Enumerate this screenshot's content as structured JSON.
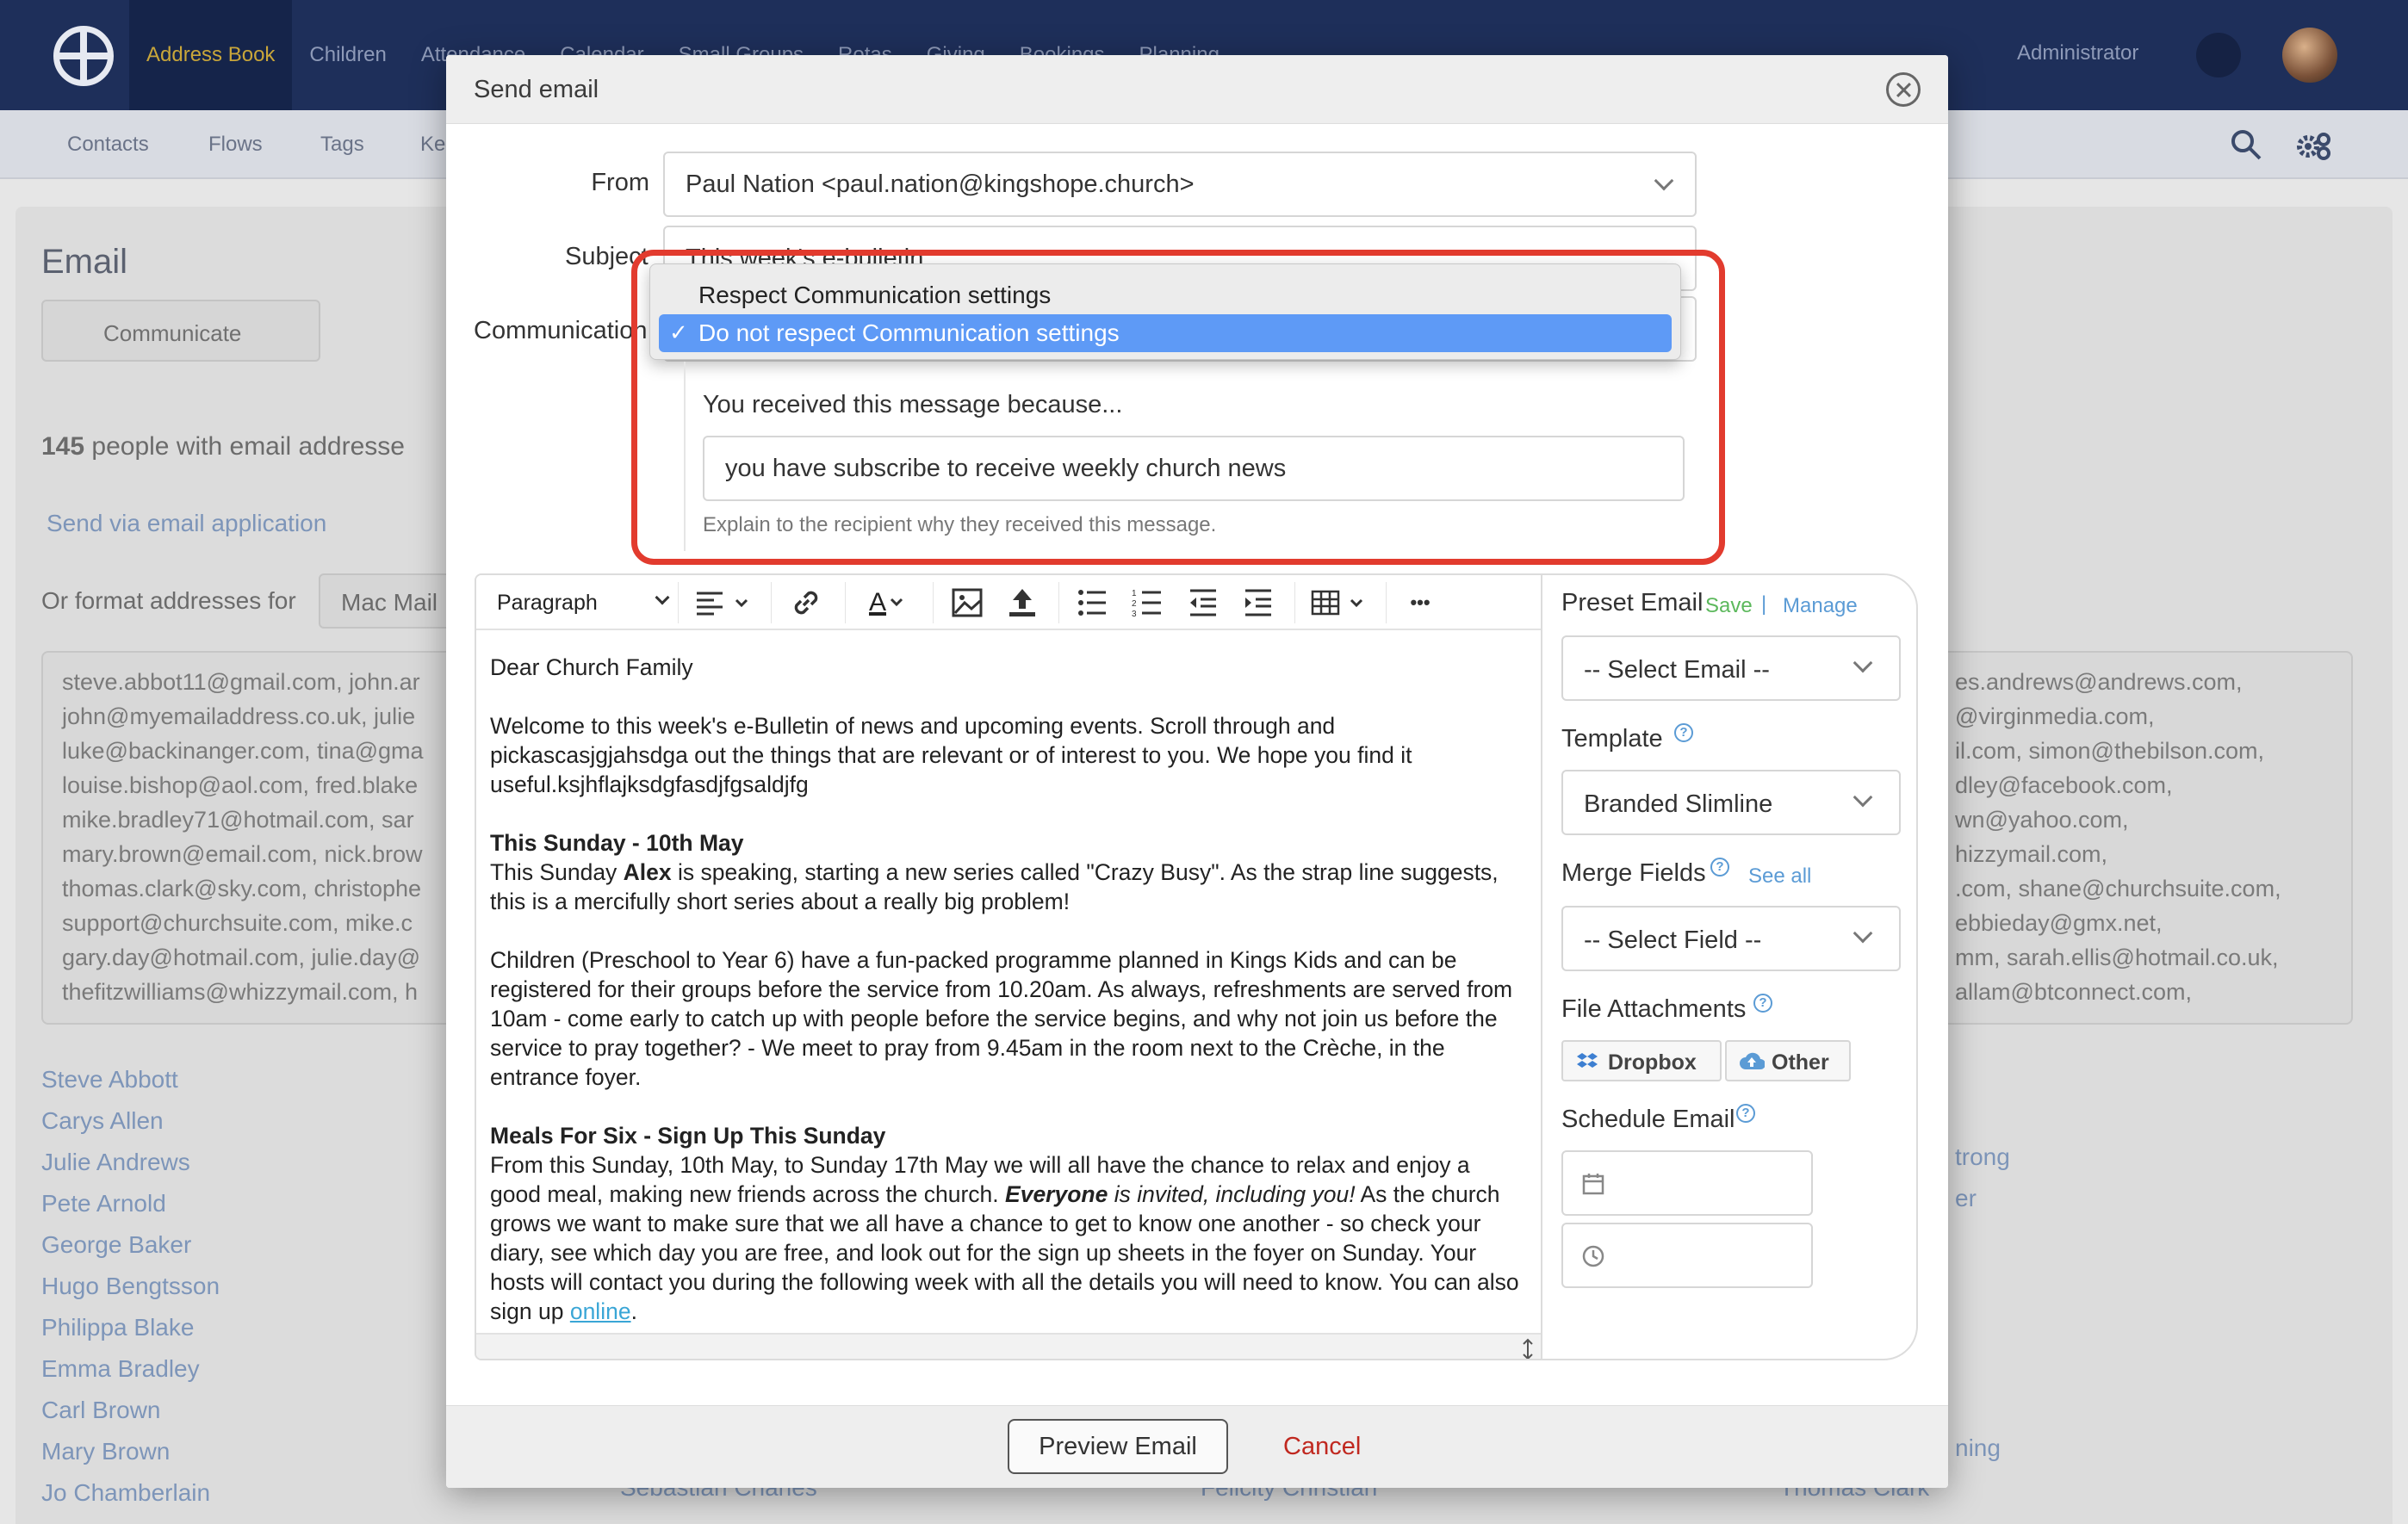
{
  "app": {
    "nav_items": [
      "Address Book",
      "Children",
      "Attendance",
      "Calendar",
      "Small Groups",
      "Rotas",
      "Giving",
      "Bookings",
      "Planning"
    ],
    "admin_label": "Administrator",
    "sub_nav": [
      "Contacts",
      "Flows",
      "Tags",
      "Ke"
    ]
  },
  "background": {
    "page_title": "Email",
    "communicate_button": "Communicate",
    "people_count_bold": "145",
    "people_count_text": " people with email addresse",
    "send_via_link": "Send via email application",
    "format_label": "Or format addresses for",
    "format_value": "Mac Mail",
    "emails_left": [
      "steve.abbot11@gmail.com, john.ar",
      "john@myemailaddress.co.uk, julie",
      "luke@backinanger.com, tina@gma",
      "louise.bishop@aol.com, fred.blake",
      "mike.bradley71@hotmail.com, sar",
      "mary.brown@email.com, nick.brow",
      "thomas.clark@sky.com, christophe",
      "support@churchsuite.com, mike.c",
      "gary.day@hotmail.com, julie.day@",
      "thefitzwilliams@whizzymail.com, h"
    ],
    "emails_right": [
      "es.andrews@andrews.com,",
      "@virginmedia.com,",
      "il.com, simon@thebilson.com,",
      "dley@facebook.com,",
      "wn@yahoo.com,",
      "hizzymail.com,",
      ".com, shane@churchsuite.com,",
      "ebbieday@gmx.net,",
      "mm, sarah.ellis@hotmail.co.uk,",
      "allam@btconnect.com,"
    ],
    "names_left": [
      "Steve Abbott",
      "Carys Allen",
      "Julie Andrews",
      "Pete Arnold",
      "George Baker",
      "Hugo Bengtsson",
      "Philippa Blake",
      "Emma Bradley",
      "Carl Brown",
      "Mary Brown",
      "Jo Chamberlain"
    ],
    "names_right": [
      "trong",
      "er"
    ],
    "names_right_low": "ning",
    "names_bottom": [
      "Sebastian Charles",
      "Felicity Christian",
      "Thomas Clark"
    ]
  },
  "modal": {
    "title": "Send email",
    "from_label": "From",
    "from_value": "Paul Nation <paul.nation@kingshope.church>",
    "subject_label": "Subject",
    "subject_value": "This week's e-bulletin",
    "communication_label": "Communication",
    "dropdown_options": [
      {
        "label": "Respect Communication settings",
        "selected": false
      },
      {
        "label": "Do not respect Communication settings",
        "selected": true
      }
    ],
    "check_mark": "✓",
    "reason_label": "You received this message because...",
    "reason_value": "you have subscribe to receive weekly church news",
    "reason_help": "Explain to the recipient why they received this message.",
    "toolbar": {
      "format_select": "Paragraph",
      "text_color_glyph": "A",
      "more_glyph": "•••"
    },
    "body": {
      "greeting": "Dear Church Family",
      "p1": "Welcome to this week's e-Bulletin of news and upcoming events. Scroll through and pickascasjgjahsdga out the things that are relevant or of interest to you. We hope you find it useful.ksjhflajksdgfasdjfgsaldjfg",
      "h1": "This Sunday - 10th May",
      "p2_a": "This Sunday ",
      "p2_b": "Alex",
      "p2_c": " is speaking, starting a new series called \"Crazy Busy\". As the strap line suggests, this is a mercifully short series about a really big problem!",
      "p3": "Children (Preschool to Year 6) have a fun-packed programme planned in Kings Kids and can be registered for their groups before the service from 10.20am. As always, refreshments are served from 10am - come early to catch up with people before the service begins, and why not join us before the service to pray together? - We meet to pray from 9.45am in the room next to the Crèche, in the entrance foyer.",
      "h2": "Meals For Six - Sign Up This Sunday",
      "p4_a": "From this Sunday, 10th May, to Sunday 17th May we will all have the chance to relax and enjoy a good meal, making new friends across the church. ",
      "p4_b": "Everyone",
      "p4_c": " is invited, including you!",
      "p4_d": " As the church grows we want to make sure that we all have a chance to get to know one another - so check your diary, see which day you are free, and look out for the sign up sheets in the foyer on Sunday. Your hosts will contact you during the following week with all the details you will need to know. You can also sign up ",
      "p4_link": "online",
      "p4_end": "."
    },
    "sidebar": {
      "preset_label": "Preset Email",
      "save_link": "Save",
      "separator": "|",
      "manage_link": "Manage",
      "preset_value": "-- Select Email --",
      "template_label": "Template",
      "template_value": "Branded Slimline",
      "merge_label": "Merge Fields",
      "see_all_link": "See all",
      "merge_value": "-- Select Field --",
      "attachments_label": "File Attachments",
      "dropbox_button": "Dropbox",
      "other_button": "Other",
      "schedule_label": "Schedule Email",
      "help_glyph": "?"
    },
    "footer": {
      "preview_button": "Preview Email",
      "cancel_link": "Cancel"
    }
  },
  "colors": {
    "nav_bg": "#1e2f5a",
    "nav_active": "#c9a63a",
    "dropdown_selected": "#5e9af6",
    "highlight": "#e23b2e",
    "cancel": "#c0281f",
    "link": "#3aa6d6",
    "save": "#5cb85c",
    "manage": "#5b9bd5"
  }
}
